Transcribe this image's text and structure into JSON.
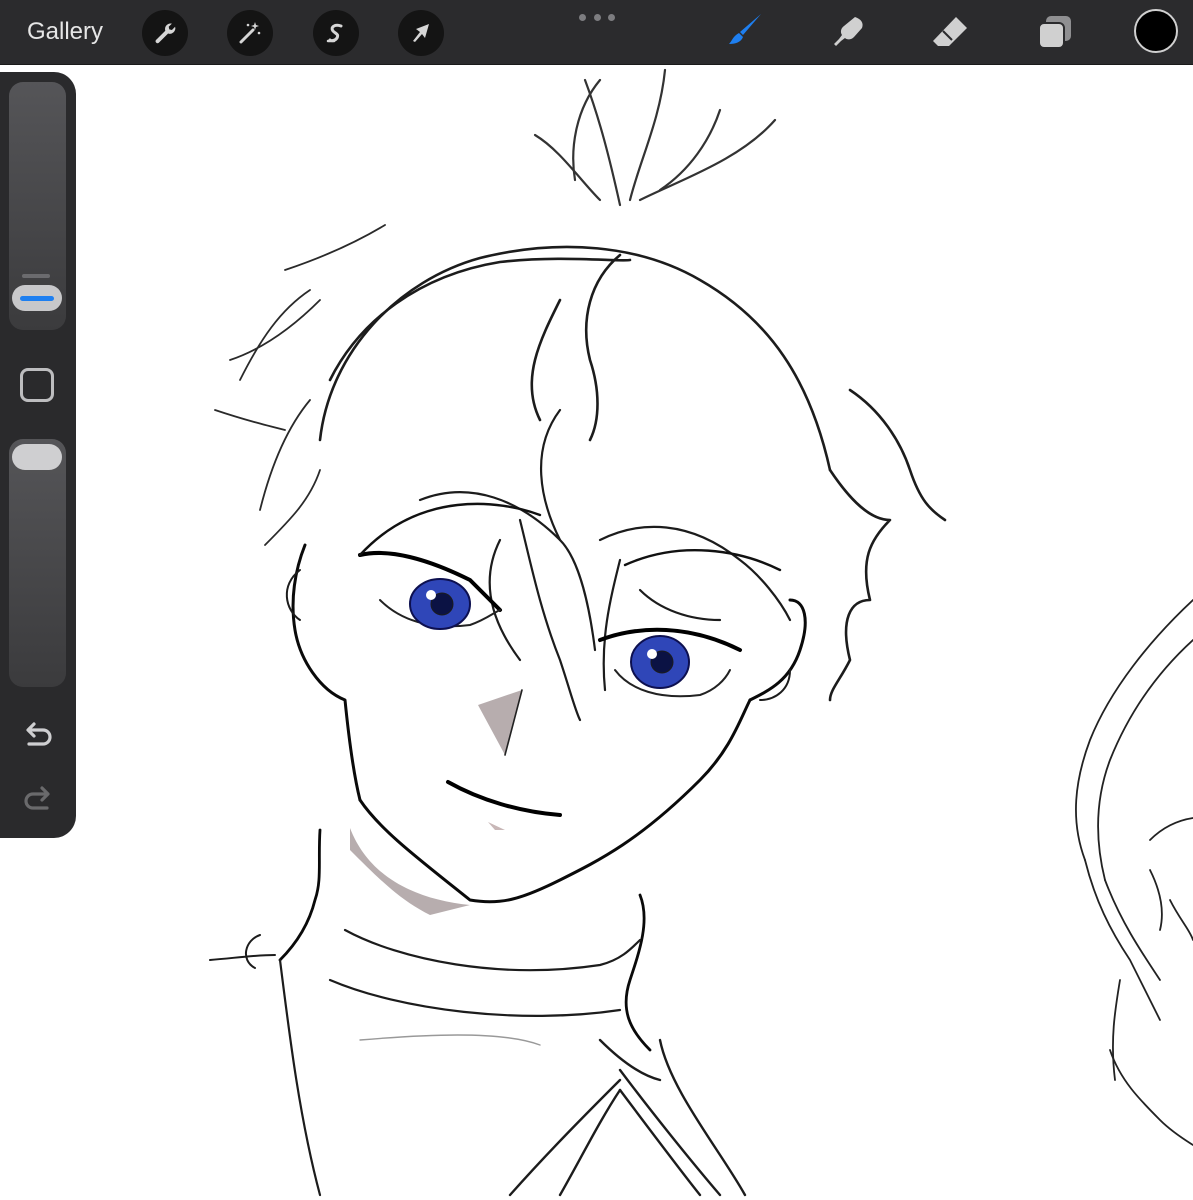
{
  "topbar": {
    "gallery_label": "Gallery",
    "left_tools": [
      "wrench-icon",
      "magic-wand-icon",
      "selection-icon",
      "transform-arrow-icon"
    ],
    "right_tools": [
      "brush-icon",
      "smudge-icon",
      "eraser-icon",
      "layers-icon"
    ],
    "active_tool": "brush-icon",
    "active_color": "#000000",
    "accent_color": "#1e7ff0"
  },
  "sidebar": {
    "brush_size_level": 0.8,
    "opacity_level": 1.0,
    "buttons": [
      "modify-button",
      "undo-button",
      "redo-button"
    ]
  },
  "canvas": {
    "content": "character-sketch",
    "eye_color": "#2f46b8",
    "skin_shadow_color": "#b7adae"
  }
}
